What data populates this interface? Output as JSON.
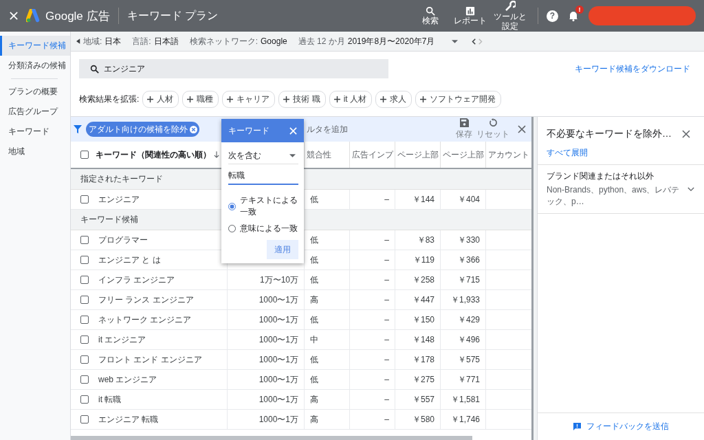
{
  "header": {
    "brand": "Google 広告",
    "title": "キーワード プラン",
    "tools": [
      {
        "kind": "search",
        "label": "検索"
      },
      {
        "kind": "report",
        "label": "レポート"
      },
      {
        "kind": "tools",
        "label": "ツールと設定"
      }
    ],
    "help_glyph": "?",
    "notification_badge": "!"
  },
  "sidebar": {
    "groups": [
      [
        {
          "label": "キーワード候補",
          "selected": true
        },
        {
          "label": "分類済みの候補",
          "selected": false
        }
      ],
      [
        {
          "label": "プランの概要",
          "selected": false
        },
        {
          "label": "広告グループ",
          "selected": false
        },
        {
          "label": "キーワード",
          "selected": false
        },
        {
          "label": "地域",
          "selected": false
        }
      ]
    ]
  },
  "context_bar": {
    "location_label": "地域:",
    "location": "日本",
    "language_label": "言語:",
    "language": "日本語",
    "network_label": "検索ネットワーク:",
    "network": "Google",
    "period_label": "過去 12 か月",
    "period": "2019年8月〜2020年7月"
  },
  "search": {
    "value": "エンジニア"
  },
  "download_link": "キーワード候補をダウンロード",
  "expand": {
    "label": "検索結果を拡張:",
    "chips": [
      "人材",
      "職種",
      "キャリア",
      "技術 職",
      "it 人材",
      "求人",
      "ソフトウェア開発"
    ]
  },
  "filter_bar": {
    "chip": "アダルト向けの候補を除外",
    "add_filter": "ルタを追加",
    "actions": [
      {
        "kind": "save",
        "label": "保存"
      },
      {
        "kind": "reset",
        "label": "リセット"
      }
    ]
  },
  "table": {
    "select_all_checked": false,
    "columns": [
      "キーワード（関連性の高い順）",
      "競合性",
      "広告インプ",
      "ページ上部",
      "ページ上部",
      "アカウント"
    ],
    "sections": [
      {
        "title": "指定されたキーワード",
        "rows": [
          {
            "keyword": "エンジニア",
            "checked": false,
            "competition": "低",
            "impressions": "–",
            "low_bid": "￥144",
            "high_bid": "￥404"
          }
        ]
      },
      {
        "title": "キーワード候補",
        "rows": [
          {
            "keyword": "プログラマー",
            "checked": false,
            "competition": "低",
            "impressions": "–",
            "low_bid": "￥83",
            "high_bid": "￥330"
          },
          {
            "keyword": "エンジニア と は",
            "checked": false,
            "competition": "低",
            "impressions": "–",
            "low_bid": "￥119",
            "high_bid": "￥366"
          },
          {
            "keyword": "インフラ エンジニア",
            "checked": false,
            "volume": "1万〜10万",
            "competition": "低",
            "impressions": "–",
            "low_bid": "￥258",
            "high_bid": "￥715"
          },
          {
            "keyword": "フリー ランス エンジニア",
            "checked": false,
            "volume": "1000〜1万",
            "competition": "高",
            "impressions": "–",
            "low_bid": "￥447",
            "high_bid": "￥1,933"
          },
          {
            "keyword": "ネットワーク エンジニア",
            "checked": false,
            "volume": "1000〜1万",
            "competition": "低",
            "impressions": "–",
            "low_bid": "￥150",
            "high_bid": "￥429"
          },
          {
            "keyword": "it エンジニア",
            "checked": false,
            "volume": "1000〜1万",
            "competition": "中",
            "impressions": "–",
            "low_bid": "￥148",
            "high_bid": "￥496"
          },
          {
            "keyword": "フロント エンド エンジニア",
            "checked": false,
            "volume": "1000〜1万",
            "competition": "低",
            "impressions": "–",
            "low_bid": "￥178",
            "high_bid": "￥575"
          },
          {
            "keyword": "web エンジニア",
            "checked": false,
            "volume": "1000〜1万",
            "competition": "低",
            "impressions": "–",
            "low_bid": "￥275",
            "high_bid": "￥771"
          },
          {
            "keyword": "it 転職",
            "checked": false,
            "volume": "1000〜1万",
            "competition": "高",
            "impressions": "–",
            "low_bid": "￥557",
            "high_bid": "￥1,581"
          },
          {
            "keyword": "エンジニア 転職",
            "checked": false,
            "volume": "1000〜1万",
            "competition": "高",
            "impressions": "–",
            "low_bid": "￥580",
            "high_bid": "￥1,746"
          }
        ]
      }
    ]
  },
  "popup": {
    "title": "キーワード",
    "operator": "次を含む",
    "value": "転職",
    "options": [
      {
        "label": "テキストによる一致",
        "selected": true
      },
      {
        "label": "意味による一致",
        "selected": false
      }
    ],
    "apply": "適用"
  },
  "panel": {
    "title": "不必要なキーワードを除外…",
    "expand_all": "すべて展開",
    "groups": [
      {
        "title": "ブランド関連またはそれ以外",
        "summary": "Non-Brands、python、aws、レバテック、p…"
      }
    ],
    "feedback": "フィードバックを送信"
  }
}
